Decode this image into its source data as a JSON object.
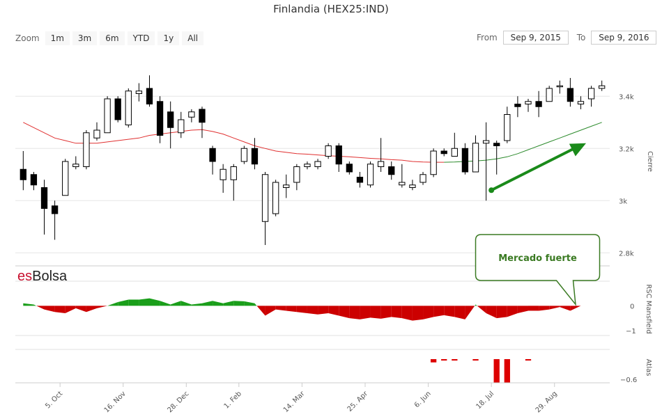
{
  "title": "Finlandia (HEX25:IND)",
  "zoom": {
    "label": "Zoom",
    "buttons": [
      "1m",
      "3m",
      "6m",
      "YTD",
      "1y",
      "All"
    ]
  },
  "range": {
    "from_label": "From",
    "from_value": "Sep 9, 2015",
    "to_label": "To",
    "to_value": "Sep 9, 2016"
  },
  "brand": {
    "es": "es",
    "bolsa": "Bolsa"
  },
  "annotation": "Mercado fuerte",
  "colors": {
    "up": "#ffffff",
    "down": "#000000",
    "ma_red": "#e03030",
    "ma_green": "#2b8a2b",
    "rsc_pos": "#1a9e1a",
    "rsc_neg": "#cc0000",
    "arrow": "#1a8a1a",
    "atlas": "#dd0000"
  },
  "chart_data": [
    {
      "type": "candlestick",
      "name": "price",
      "axis_title": "Cierre",
      "y_ticks": [
        "2.8k",
        "3k",
        "3.2k",
        "3.4k"
      ],
      "ylim": [
        2750,
        3550
      ],
      "x_labels": [
        "5. Oct",
        "16. Nov",
        "28. Dec",
        "1. Feb",
        "14. Mar",
        "25. Apr",
        "6. Jun",
        "18. Jul",
        "29. Aug"
      ],
      "x_label_index": [
        3.5,
        9.5,
        15.5,
        20.5,
        26.5,
        32.5,
        38.5,
        44.5,
        50.5
      ],
      "candles": [
        [
          3120,
          3190,
          3040,
          3080
        ],
        [
          3100,
          3110,
          3040,
          3060
        ],
        [
          3050,
          3080,
          2870,
          2970
        ],
        [
          2980,
          3000,
          2850,
          2950
        ],
        [
          3020,
          3160,
          3020,
          3150
        ],
        [
          3130,
          3170,
          3120,
          3140
        ],
        [
          3130,
          3270,
          3120,
          3260
        ],
        [
          3240,
          3300,
          3230,
          3270
        ],
        [
          3260,
          3400,
          3260,
          3390
        ],
        [
          3390,
          3400,
          3300,
          3310
        ],
        [
          3290,
          3430,
          3280,
          3420
        ],
        [
          3410,
          3450,
          3380,
          3420
        ],
        [
          3430,
          3480,
          3360,
          3370
        ],
        [
          3380,
          3400,
          3220,
          3250
        ],
        [
          3340,
          3380,
          3200,
          3280
        ],
        [
          3260,
          3340,
          3240,
          3310
        ],
        [
          3320,
          3350,
          3300,
          3340
        ],
        [
          3350,
          3360,
          3240,
          3300
        ],
        [
          3200,
          3210,
          3100,
          3150
        ],
        [
          3080,
          3140,
          3030,
          3120
        ],
        [
          3080,
          3140,
          3000,
          3130
        ],
        [
          3150,
          3210,
          3140,
          3200
        ],
        [
          3200,
          3240,
          3120,
          3140
        ],
        [
          2920,
          3110,
          2830,
          3100
        ],
        [
          2950,
          3080,
          2940,
          3070
        ],
        [
          3050,
          3100,
          3010,
          3060
        ],
        [
          3070,
          3140,
          3040,
          3130
        ],
        [
          3130,
          3150,
          3120,
          3140
        ],
        [
          3130,
          3160,
          3120,
          3150
        ],
        [
          3170,
          3220,
          3160,
          3210
        ],
        [
          3210,
          3220,
          3110,
          3140
        ],
        [
          3140,
          3150,
          3100,
          3110
        ],
        [
          3090,
          3110,
          3050,
          3070
        ],
        [
          3060,
          3150,
          3050,
          3140
        ],
        [
          3130,
          3240,
          3110,
          3150
        ],
        [
          3130,
          3150,
          3080,
          3100
        ],
        [
          3060,
          3140,
          3050,
          3070
        ],
        [
          3050,
          3080,
          3040,
          3060
        ],
        [
          3070,
          3110,
          3060,
          3100
        ],
        [
          3100,
          3200,
          3090,
          3190
        ],
        [
          3190,
          3200,
          3170,
          3180
        ],
        [
          3170,
          3260,
          3170,
          3200
        ],
        [
          3200,
          3220,
          3100,
          3110
        ],
        [
          3110,
          3250,
          3110,
          3220
        ],
        [
          3220,
          3300,
          3000,
          3230
        ],
        [
          3220,
          3230,
          3100,
          3210
        ],
        [
          3230,
          3360,
          3220,
          3330
        ],
        [
          3370,
          3400,
          3320,
          3360
        ],
        [
          3370,
          3390,
          3340,
          3380
        ],
        [
          3380,
          3420,
          3320,
          3360
        ],
        [
          3380,
          3440,
          3380,
          3430
        ],
        [
          3440,
          3460,
          3410,
          3440
        ],
        [
          3430,
          3470,
          3360,
          3380
        ],
        [
          3370,
          3400,
          3350,
          3380
        ],
        [
          3390,
          3440,
          3360,
          3430
        ],
        [
          3430,
          3460,
          3420,
          3440
        ]
      ],
      "ma": [
        3300,
        3280,
        3260,
        3240,
        3230,
        3220,
        3220,
        3220,
        3225,
        3230,
        3235,
        3240,
        3250,
        3255,
        3260,
        3265,
        3270,
        3272,
        3265,
        3255,
        3240,
        3225,
        3210,
        3200,
        3190,
        3185,
        3180,
        3178,
        3175,
        3172,
        3170,
        3168,
        3165,
        3162,
        3160,
        3157,
        3155,
        3150,
        3148,
        3147,
        3147,
        3148,
        3150,
        3152,
        3155,
        3160,
        3168,
        3180,
        3195,
        3210,
        3225,
        3240,
        3255,
        3270,
        3285,
        3300
      ],
      "ma_red_until": 40
    },
    {
      "type": "area",
      "name": "rsc",
      "axis_title": "RSC Mansfield",
      "y_ticks": [
        "0",
        "−1"
      ],
      "ylim": [
        -1.2,
        0.6
      ],
      "values": [
        0.1,
        0.05,
        -0.15,
        -0.25,
        -0.3,
        -0.1,
        -0.25,
        -0.1,
        0,
        0.15,
        0.25,
        0.25,
        0.3,
        0.2,
        0.05,
        0.2,
        0.05,
        0.1,
        0.2,
        0.1,
        0.2,
        0.18,
        0.1,
        -0.4,
        -0.15,
        -0.2,
        -0.25,
        -0.3,
        -0.35,
        -0.3,
        -0.4,
        -0.5,
        -0.55,
        -0.48,
        -0.52,
        -0.45,
        -0.5,
        -0.6,
        -0.55,
        -0.45,
        -0.38,
        -0.45,
        -0.55,
        0.05,
        -0.3,
        -0.5,
        -0.45,
        -0.3,
        -0.2,
        -0.2,
        -0.15,
        -0.05,
        -0.2,
        0,
        0,
        0
      ]
    },
    {
      "type": "bar",
      "name": "atlas",
      "axis_title": "Atlas",
      "y_ticks": [
        "−0.6"
      ],
      "ylim": [
        -0.6,
        0
      ],
      "bars": [
        [
          39,
          -0.2
        ],
        [
          40,
          -0.06
        ],
        [
          41,
          -0.02
        ],
        [
          43,
          -0.02
        ],
        [
          45,
          -0.6
        ],
        [
          46,
          -0.6
        ],
        [
          48,
          -0.12
        ]
      ]
    }
  ]
}
